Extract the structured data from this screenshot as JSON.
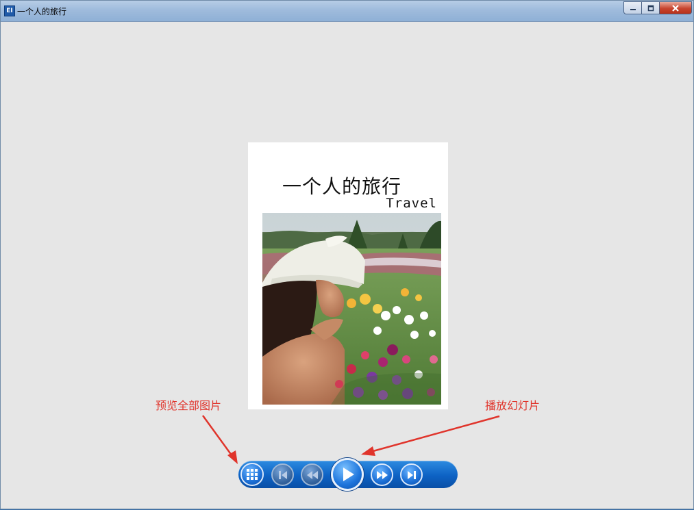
{
  "window": {
    "title": "一个人的旅行",
    "icon": "app-icon",
    "icon_label": "EI",
    "controls": [
      "minimize-icon",
      "maximize-icon",
      "close-icon"
    ]
  },
  "page": {
    "title": "一个人的旅行",
    "subtitle": "Travel",
    "photo": "woman-with-flowers-photo"
  },
  "annotations": {
    "left": "预览全部图片",
    "right": "播放幻灯片",
    "color": "#e0342b"
  },
  "toolbar": {
    "color": "#0d62c4",
    "buttons": [
      {
        "name": "preview-all-button",
        "icon": "grid-icon"
      },
      {
        "name": "first-page-button",
        "icon": "skip-back-icon"
      },
      {
        "name": "previous-page-button",
        "icon": "rewind-icon"
      },
      {
        "name": "play-slideshow-button",
        "icon": "play-icon"
      },
      {
        "name": "next-page-button",
        "icon": "fast-forward-icon"
      },
      {
        "name": "last-page-button",
        "icon": "skip-forward-icon"
      }
    ]
  }
}
